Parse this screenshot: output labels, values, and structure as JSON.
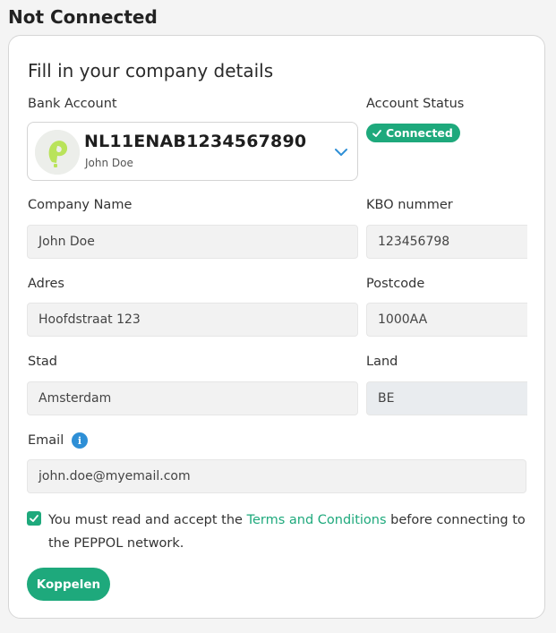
{
  "page": {
    "title": "Not Connected"
  },
  "form": {
    "title": "Fill in your company details",
    "bank_account": {
      "label": "Bank Account",
      "iban": "NL11ENAB1234567890",
      "holder": "John Doe",
      "logo_icon": "bank-logo-icon",
      "dropdown_icon": "chevron-down-icon"
    },
    "account_status": {
      "label": "Account Status",
      "badge": "Connected",
      "badge_icon": "check-icon",
      "badge_color": "#1ea97c"
    },
    "company_name": {
      "label": "Company Name",
      "value": "John Doe"
    },
    "kbo": {
      "label": "KBO nummer",
      "value": "123456798"
    },
    "adres": {
      "label": "Adres",
      "value": "Hoofdstraat 123"
    },
    "postcode": {
      "label": "Postcode",
      "value": "1000AA"
    },
    "stad": {
      "label": "Stad",
      "value": "Amsterdam"
    },
    "land": {
      "label": "Land",
      "value": "BE"
    },
    "email": {
      "label": "Email",
      "value": "john.doe@myemail.com",
      "info_icon": "info-icon"
    },
    "consent": {
      "checked": true,
      "text_before": "You must read and accept the ",
      "link": "Terms and Conditions",
      "text_after": " before connecting to the PEPPOL network."
    },
    "submit_label": "Koppelen"
  },
  "colors": {
    "accent": "#1ea97c",
    "info": "#2e8fd6"
  }
}
